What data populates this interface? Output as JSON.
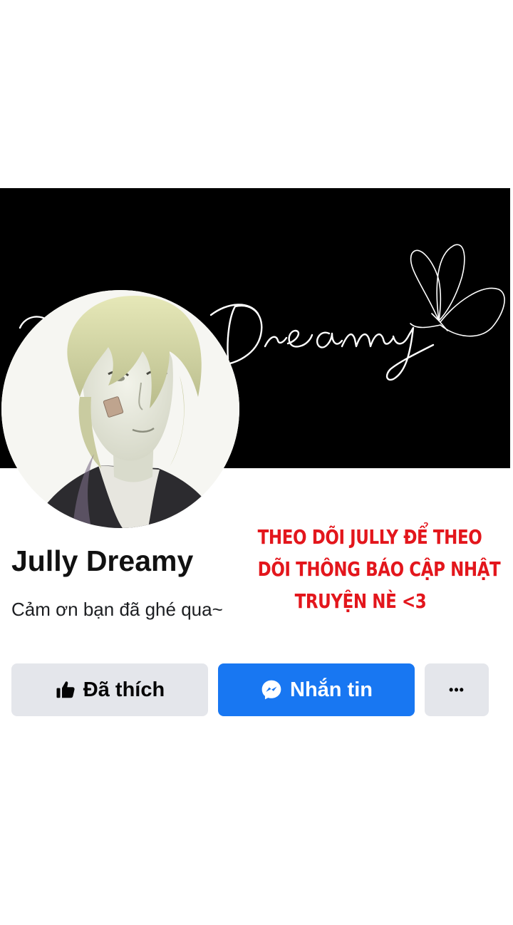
{
  "cover": {
    "script_text": "Dreamy",
    "background": "#000000",
    "icon": "butterfly-icon"
  },
  "profile": {
    "name": "Jully Dreamy",
    "bio": "Cảm ơn bạn đã ghé qua~",
    "avatar_icon": "avatar"
  },
  "promo": {
    "line1": "THEO DÕI JULLY ĐỂ THEO",
    "line2": "DÕI THÔNG BÁO CẬP NHẬT",
    "line3": "TRUYỆN NÈ <3",
    "color": "#e3161c"
  },
  "actions": {
    "like_label": "Đã thích",
    "like_icon": "thumbs-up-icon",
    "message_label": "Nhắn tin",
    "message_icon": "messenger-icon",
    "more_label": "•••",
    "more_icon": "more-icon",
    "accent_color": "#1877f2",
    "neutral_color": "#e4e6eb"
  }
}
